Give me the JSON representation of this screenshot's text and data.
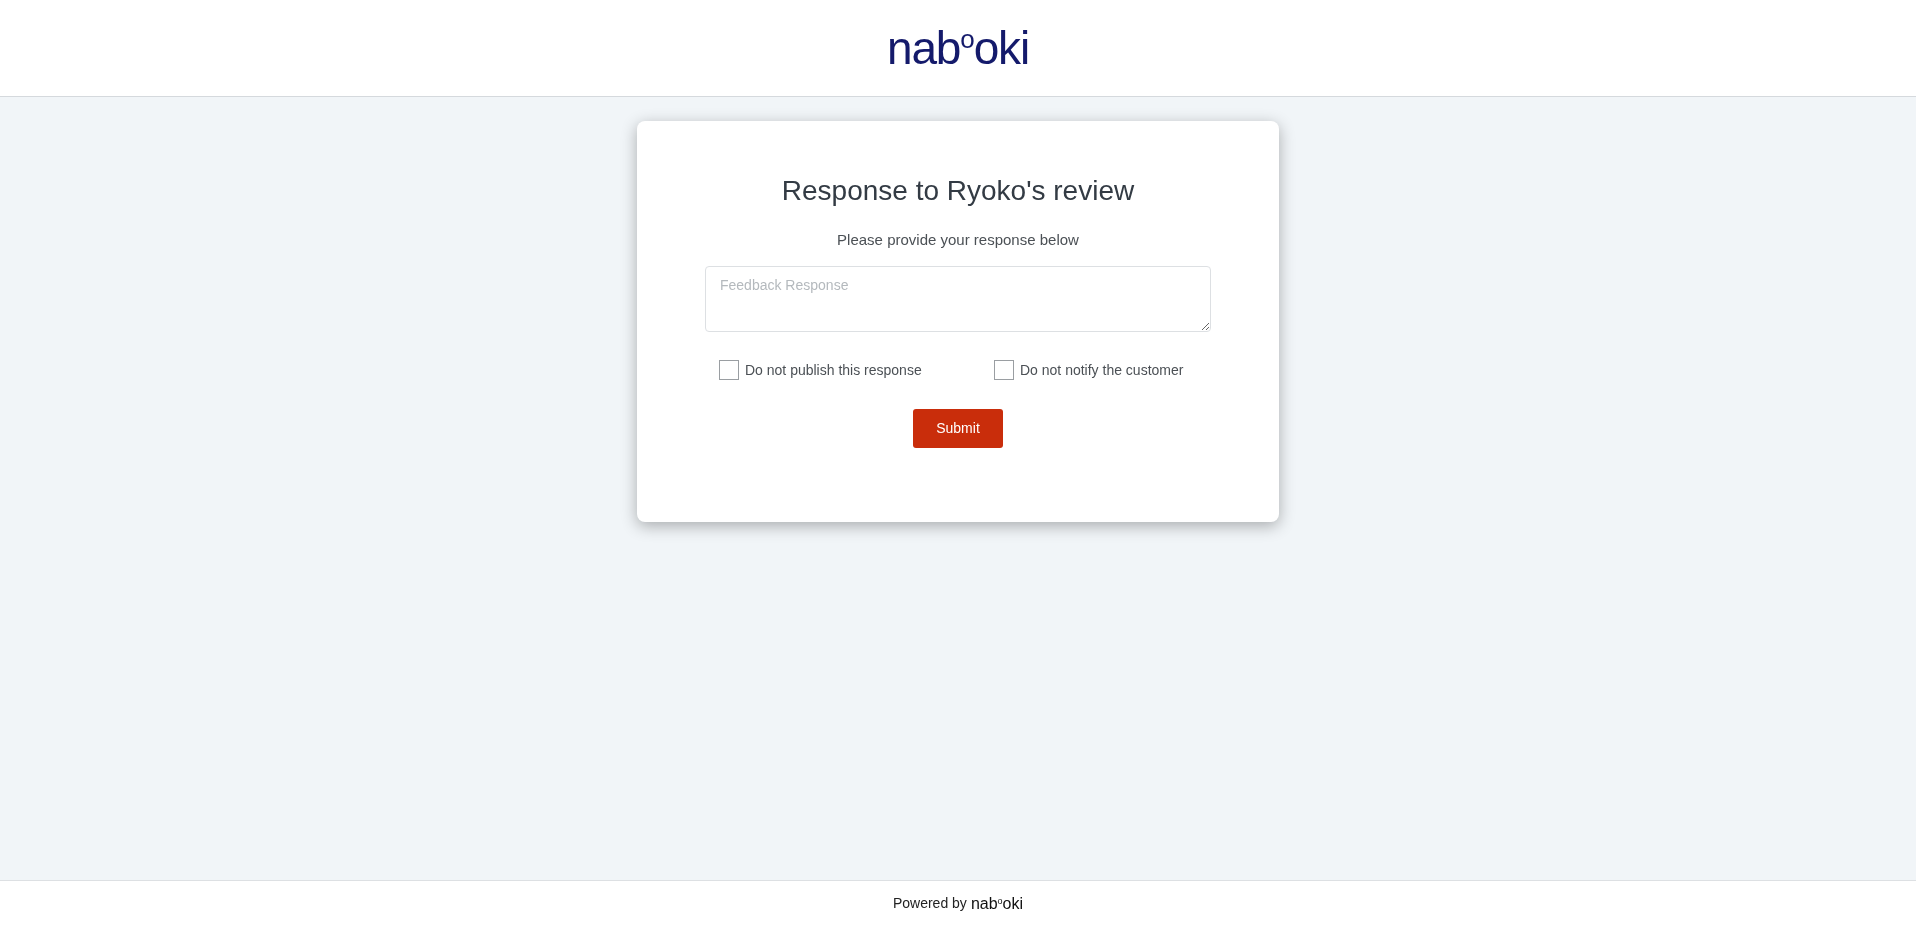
{
  "header": {
    "logo": "nab$^{o}$oki"
  },
  "card": {
    "title": "Response to Ryoko's review",
    "subtitle": "Please provide your response below",
    "response_field": {
      "placeholder": "Feedback Response"
    },
    "options": [
      {
        "label": "Do not publish this response",
        "checked": false
      },
      {
        "label": "Do not notify the customer",
        "checked": false
      }
    ],
    "submit": "Submit"
  },
  "footer": {
    "powered_by": "Powered by",
    "logo": "nab$^{o}$oki"
  }
}
